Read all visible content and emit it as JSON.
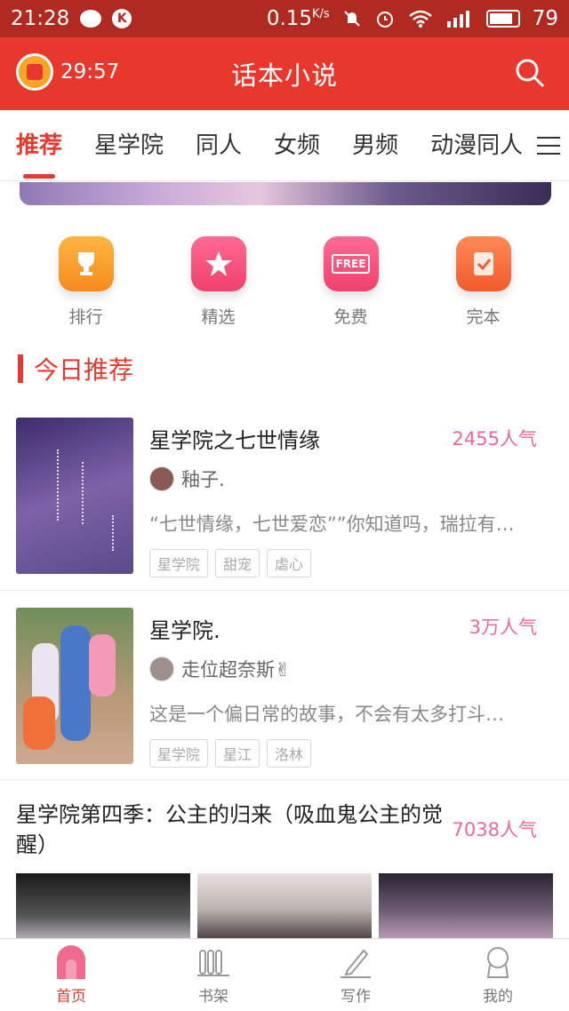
{
  "status": {
    "time": "21:28",
    "speed": "0.15",
    "speed_unit": "K/s",
    "battery": "79",
    "k_badge": "K"
  },
  "appbar": {
    "timer": "29:57",
    "title": "话本小说"
  },
  "tabs": [
    {
      "label": "推荐"
    },
    {
      "label": "星学院"
    },
    {
      "label": "同人"
    },
    {
      "label": "女频"
    },
    {
      "label": "男频"
    },
    {
      "label": "动漫同人"
    }
  ],
  "quick": [
    {
      "label": "排行",
      "icon": "trophy-icon",
      "color": "#f5a623"
    },
    {
      "label": "精选",
      "icon": "star-icon",
      "color": "#f24f7c"
    },
    {
      "label": "免费",
      "icon": "free-icon",
      "color": "#f24f7c",
      "badge": "FREE"
    },
    {
      "label": "完本",
      "icon": "check-icon",
      "color": "#f56a3a"
    }
  ],
  "section": {
    "title": "今日推荐"
  },
  "books": [
    {
      "title": "星学院之七世情缘",
      "popularity": "2455人气",
      "author": "釉子.",
      "desc": "“七世情缘，七世爱恋””你知道吗，瑞拉有…",
      "tags": [
        "星学院",
        "甜宠",
        "虐心"
      ]
    },
    {
      "title": "星学院.",
      "popularity": "3万人气",
      "author": "走位超奈斯✌",
      "desc": "这是一个偏日常的故事，不会有太多打斗…",
      "tags": [
        "星学院",
        "星江",
        "洛林"
      ]
    }
  ],
  "featured": {
    "title": "星学院第四季：公主的归来（吸血鬼公主的觉醒）",
    "popularity": "7038人气"
  },
  "nav": [
    {
      "label": "首页",
      "icon": "home-icon"
    },
    {
      "label": "书架",
      "icon": "bookshelf-icon"
    },
    {
      "label": "写作",
      "icon": "write-icon"
    },
    {
      "label": "我的",
      "icon": "profile-icon"
    }
  ],
  "colors": {
    "primary": "#e8382e",
    "status_bar": "#b02a21",
    "accent_pink": "#ec6a9a"
  }
}
